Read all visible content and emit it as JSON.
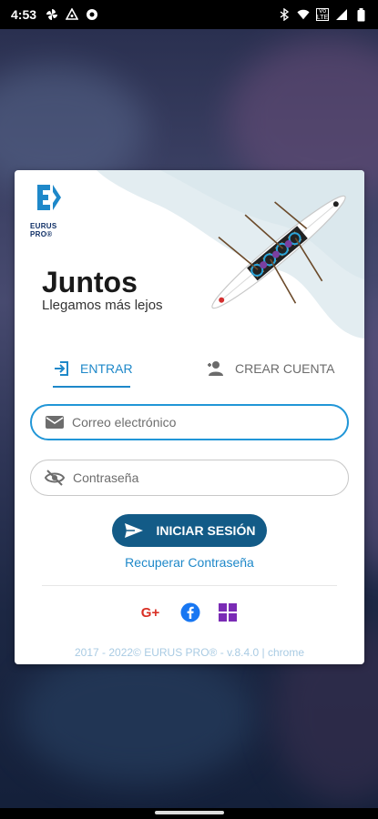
{
  "status_bar": {
    "time": "4:53",
    "left_icons": [
      "pinwheel-icon",
      "delta-icon",
      "circle-icon"
    ],
    "right_icons": [
      "bluetooth-icon",
      "wifi-icon",
      "volte-icon",
      "signal-icon",
      "battery-icon"
    ],
    "volte_label": "Vo\nLTE"
  },
  "brand": {
    "name": "EURUS PRO®",
    "accent": "#1e88c9",
    "dark_blue": "#135b87"
  },
  "hero": {
    "title": "Juntos",
    "subtitle": "Llegamos más lejos"
  },
  "tabs": [
    {
      "label": "ENTRAR",
      "icon": "login-icon",
      "active": true
    },
    {
      "label": "CREAR CUENTA",
      "icon": "person-add-icon",
      "active": false
    }
  ],
  "form": {
    "email_placeholder": "Correo electrónico",
    "email_value": "",
    "password_placeholder": "Contraseña",
    "password_value": ""
  },
  "actions": {
    "login_label": "INICIAR SESIÓN",
    "recover_label": "Recuperar Contraseña"
  },
  "social": {
    "google_label": "G+",
    "icons": [
      "google-plus-icon",
      "facebook-icon",
      "microsoft-icon"
    ]
  },
  "footer": {
    "text": "2017 - 2022© EURUS PRO® - v.8.4.0 | chrome"
  }
}
